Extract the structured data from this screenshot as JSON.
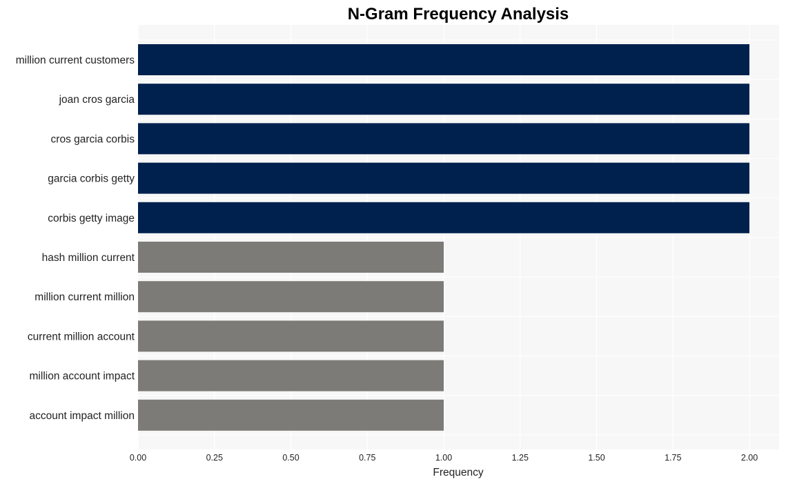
{
  "chart_data": {
    "type": "bar",
    "orientation": "horizontal",
    "title": "N-Gram Frequency Analysis",
    "xlabel": "Frequency",
    "ylabel": "",
    "categories": [
      "million current customers",
      "joan cros garcia",
      "cros garcia corbis",
      "garcia corbis getty",
      "corbis getty image",
      "hash million current",
      "million current million",
      "current million account",
      "million account impact",
      "account impact million"
    ],
    "values": [
      2,
      2,
      2,
      2,
      2,
      1,
      1,
      1,
      1,
      1
    ],
    "bar_colors": [
      "#00214e",
      "#00214e",
      "#00214e",
      "#00214e",
      "#00214e",
      "#7d7b77",
      "#7d7b77",
      "#7d7b77",
      "#7d7b77",
      "#7d7b77"
    ],
    "xlim": [
      0,
      2.1
    ],
    "xticks": [
      0,
      0.25,
      0.5,
      0.75,
      1.0,
      1.25,
      1.5,
      1.75,
      2.0
    ],
    "xtick_labels": [
      "0.00",
      "0.25",
      "0.50",
      "0.75",
      "1.00",
      "1.25",
      "1.50",
      "1.75",
      "2.00"
    ],
    "grid": true,
    "legend": "none",
    "background_color": "#f7f7f7",
    "grid_color": "#ffffff"
  }
}
